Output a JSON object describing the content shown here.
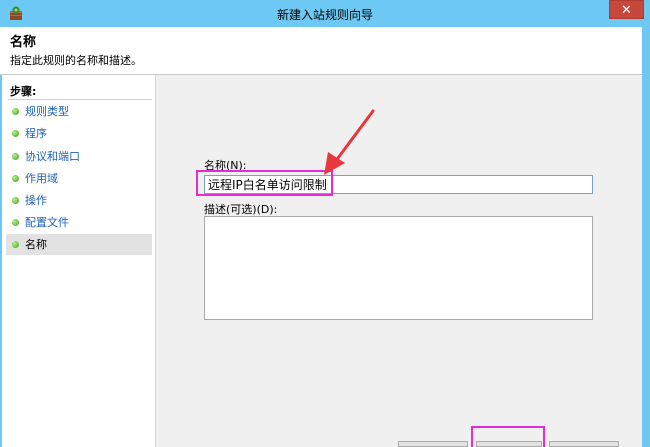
{
  "window": {
    "title": "新建入站规则向导",
    "close_glyph": "✕",
    "accent": "#6dc8f4"
  },
  "header": {
    "title": "名称",
    "description": "指定此规则的名称和描述。"
  },
  "sidebar": {
    "title": "步骤:",
    "items": [
      {
        "label": "规则类型",
        "active": false
      },
      {
        "label": "程序",
        "active": false
      },
      {
        "label": "协议和端口",
        "active": false
      },
      {
        "label": "作用域",
        "active": false
      },
      {
        "label": "操作",
        "active": false
      },
      {
        "label": "配置文件",
        "active": false
      },
      {
        "label": "名称",
        "active": true
      }
    ]
  },
  "form": {
    "name_label": "名称(N):",
    "name_value": "远程IP白名单访问限制",
    "description_label": "描述(可选)(D):",
    "description_value": ""
  },
  "annotations": {
    "highlight_color": "#e42bd8",
    "arrow_color": "#e8383d"
  }
}
